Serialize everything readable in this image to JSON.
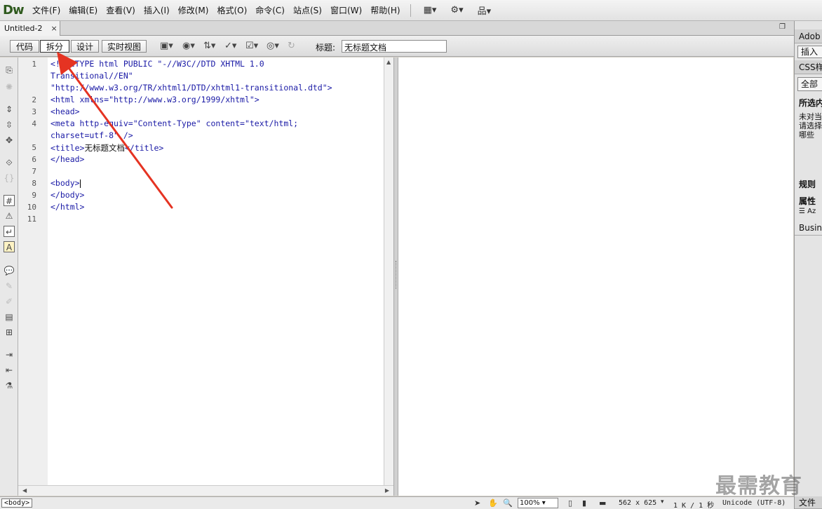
{
  "app": {
    "logo": "Dw"
  },
  "menu": {
    "items": [
      "文件(F)",
      "编辑(E)",
      "查看(V)",
      "插入(I)",
      "修改(M)",
      "格式(O)",
      "命令(C)",
      "站点(S)",
      "窗口(W)",
      "帮助(H)"
    ],
    "icons": [
      "layout-icon",
      "gear-icon",
      "site-icon"
    ]
  },
  "tab": {
    "label": "Untitled-2",
    "close": "×"
  },
  "doc_toolbar": {
    "code_label": "代码",
    "split_label": "拆分",
    "design_label": "设计",
    "live_label": "实时视图",
    "title_label": "标题:",
    "title_value": "无标题文档"
  },
  "editor": {
    "line_numbers": [
      "1",
      "2",
      "3",
      "4",
      "5",
      "6",
      "7",
      "8",
      "9",
      "10",
      "11"
    ],
    "lines": [
      "<!DOCTYPE html PUBLIC \"-//W3C//DTD XHTML 1.0",
      "Transitional//EN\"",
      "\"http://www.w3.org/TR/xhtml1/DTD/xhtml1-transitional.dtd\">",
      "<html xmlns=\"http://www.w3.org/1999/xhtml\">",
      "<head>",
      "<meta http-equiv=\"Content-Type\" content=\"text/html;",
      "charset=utf-8\" />",
      "<title>",
      "无标题文档",
      "</title>",
      "</head>",
      "<body>",
      "</body>",
      "</html>"
    ]
  },
  "status": {
    "tag": "<body>",
    "zoom": "100%",
    "dimensions": "562 x 625",
    "size": "1 K / 1 秒",
    "encoding": "Unicode (UTF-8)"
  },
  "right_panel": {
    "items": [
      "Adob",
      "插入",
      "CSS样",
      "全部",
      "所选内",
      "未对当",
      "请选择",
      "哪些",
      "规则",
      "属性",
      "Busin",
      "文件"
    ]
  },
  "watermark": "最需教育",
  "colors": {
    "code_tag": "#1a1aa6",
    "arrow": "#e53322",
    "logo": "#2f5a1e"
  }
}
